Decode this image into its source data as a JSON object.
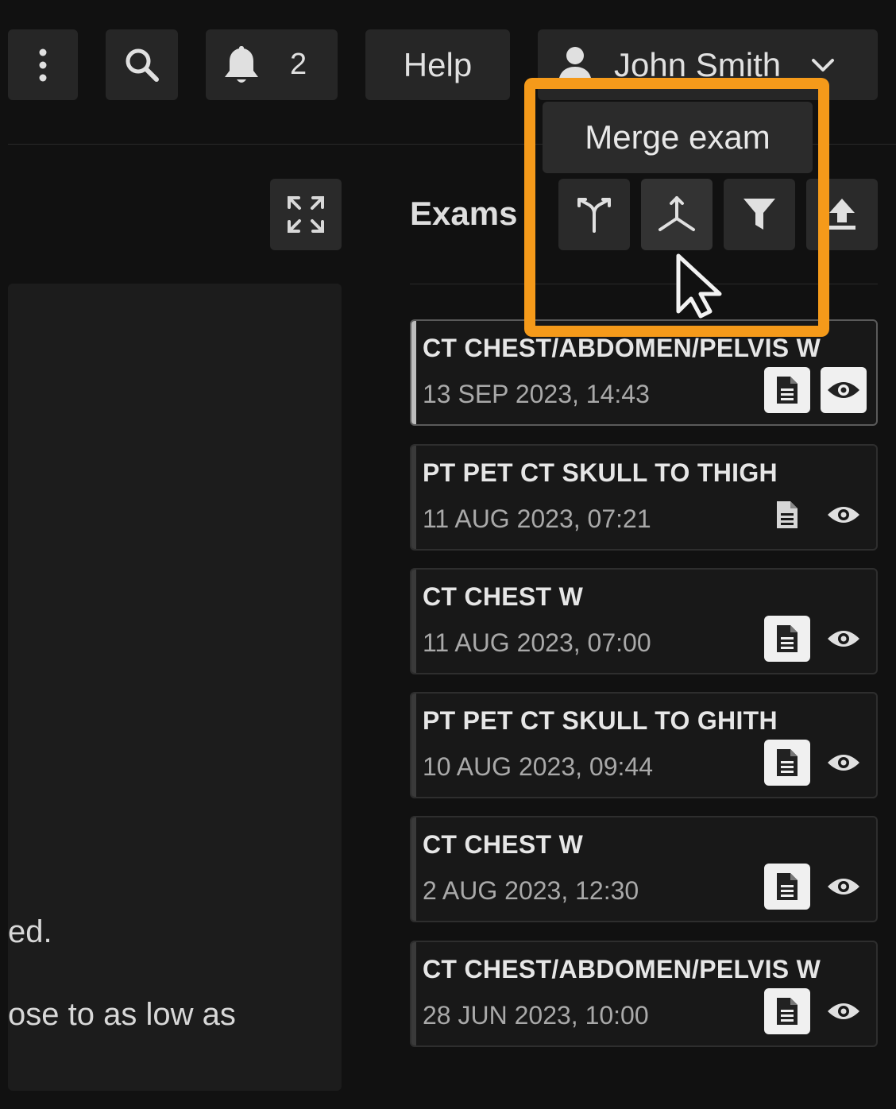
{
  "header": {
    "notification_count": "2",
    "help_label": "Help",
    "user_name": "John Smith"
  },
  "left_panel": {
    "text_line_1": "ed.",
    "text_line_2": "ose to as low as"
  },
  "exams_panel": {
    "title": "Exams",
    "tooltip": "Merge exam",
    "toolbar_icons": [
      "split-icon",
      "merge-icon",
      "filter-icon",
      "upload-icon"
    ]
  },
  "exams": [
    {
      "title": "CT CHEST/ABDOMEN/PELVIS W",
      "date": "13 SEP 2023, 14:43"
    },
    {
      "title": "PT PET CT SKULL TO THIGH",
      "date": "11 AUG 2023, 07:21"
    },
    {
      "title": "CT CHEST W",
      "date": "11 AUG 2023, 07:00"
    },
    {
      "title": "PT PET CT SKULL TO GHITH",
      "date": "10 AUG 2023, 09:44"
    },
    {
      "title": "CT CHEST W",
      "date": "2 AUG 2023, 12:30"
    },
    {
      "title": "CT CHEST/ABDOMEN/PELVIS W",
      "date": "28 JUN 2023, 10:00"
    }
  ],
  "colors": {
    "highlight": "#f59a1a",
    "background": "#111111"
  }
}
